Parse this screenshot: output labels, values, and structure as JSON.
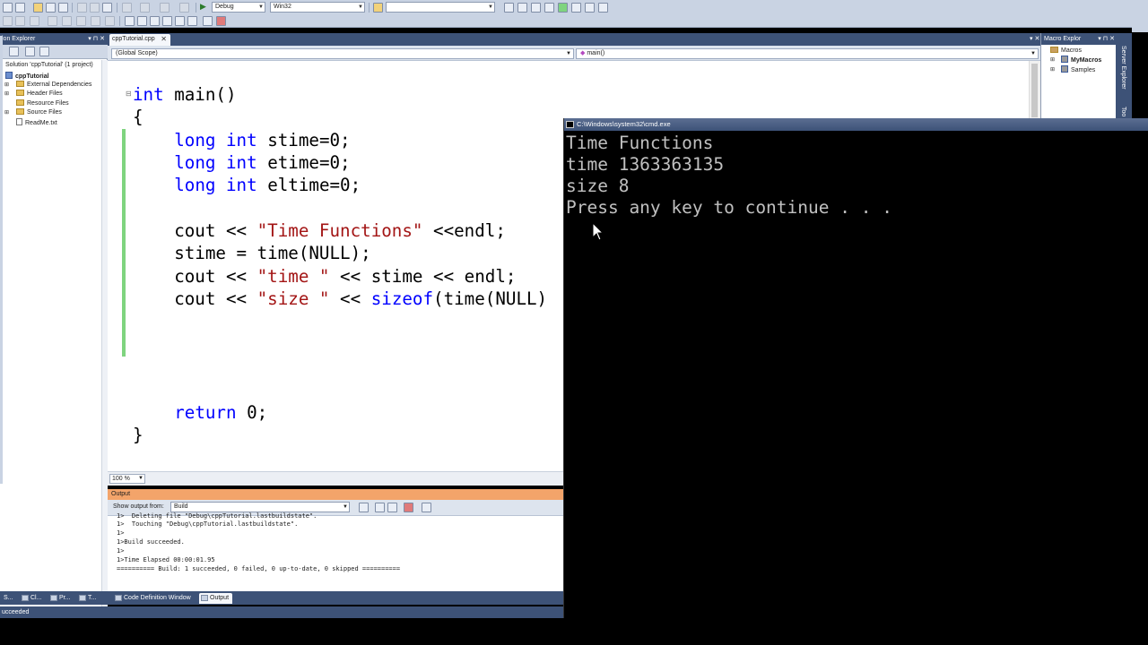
{
  "toolbar": {
    "config_combo": "Debug",
    "platform_combo": "Win32",
    "find_combo": ""
  },
  "solution_explorer": {
    "title": "ion Explorer",
    "pin": "▾ ⊓ ✕",
    "items": [
      {
        "label": "Solution 'cppTutorial' (1 project)",
        "icon": "solution-icon"
      },
      {
        "label": "cppTutorial",
        "icon": "project-icon"
      },
      {
        "label": "External Dependencies",
        "icon": "folder-icon"
      },
      {
        "label": "Header Files",
        "icon": "folder-icon"
      },
      {
        "label": "Resource Files",
        "icon": "folder-icon"
      },
      {
        "label": "Source Files",
        "icon": "folder-icon"
      },
      {
        "label": "ReadMe.txt",
        "icon": "document-icon"
      }
    ]
  },
  "editor": {
    "tab_label": "cppTutorial.cpp",
    "scope_combo": "(Global Scope)",
    "member_combo": "main()",
    "zoom": "100 %",
    "code_lines": [
      "int main()",
      "{",
      "    long int stime=0;",
      "    long int etime=0;",
      "    long int eltime=0;",
      "",
      "    cout << \"Time Functions\" <<endl;",
      "    stime = time(NULL);",
      "    cout << \"time \" << stime << endl;",
      "    cout << \"size \" << sizeof(time(NULL)",
      "",
      "",
      "",
      "",
      "    return 0;",
      "}"
    ]
  },
  "output": {
    "title": "Output",
    "show_from_label": "Show output from:",
    "show_from_value": "Build",
    "lines": [
      "1>  Deleting file \"Debug\\cppTutorial.lastbuildstate\".",
      "1>  Touching \"Debug\\cppTutorial.lastbuildstate\".",
      "1>",
      "1>Build succeeded.",
      "1>",
      "1>Time Elapsed 00:00:01.95",
      "========== Build: 1 succeeded, 0 failed, 0 up-to-date, 0 skipped =========="
    ]
  },
  "bottom_tabs": {
    "left": [
      "S...",
      "Cl...",
      "Pr...",
      "T..."
    ],
    "code_definition": "Code Definition Window",
    "output": "Output"
  },
  "status": {
    "text": "ucceeded"
  },
  "macro_explorer": {
    "title": "Macro Explor",
    "ctrls": "▾ ⊓ ✕",
    "items": [
      "Macros",
      "MyMacros",
      "Samples"
    ]
  },
  "side_strip": {
    "server_explorer": "Server Explorer",
    "toolbox": "Too"
  },
  "cmd": {
    "title": "C:\\Windows\\system32\\cmd.exe",
    "lines": [
      "Time Functions",
      "time 1363363135",
      "size 8",
      "Press any key to continue . . ."
    ]
  },
  "colors": {
    "ide_blue": "#3d5277",
    "keyword": "#0000ff",
    "string": "#a31515",
    "console_text": "#c0c0c0",
    "output_header": "#f3a46a"
  }
}
